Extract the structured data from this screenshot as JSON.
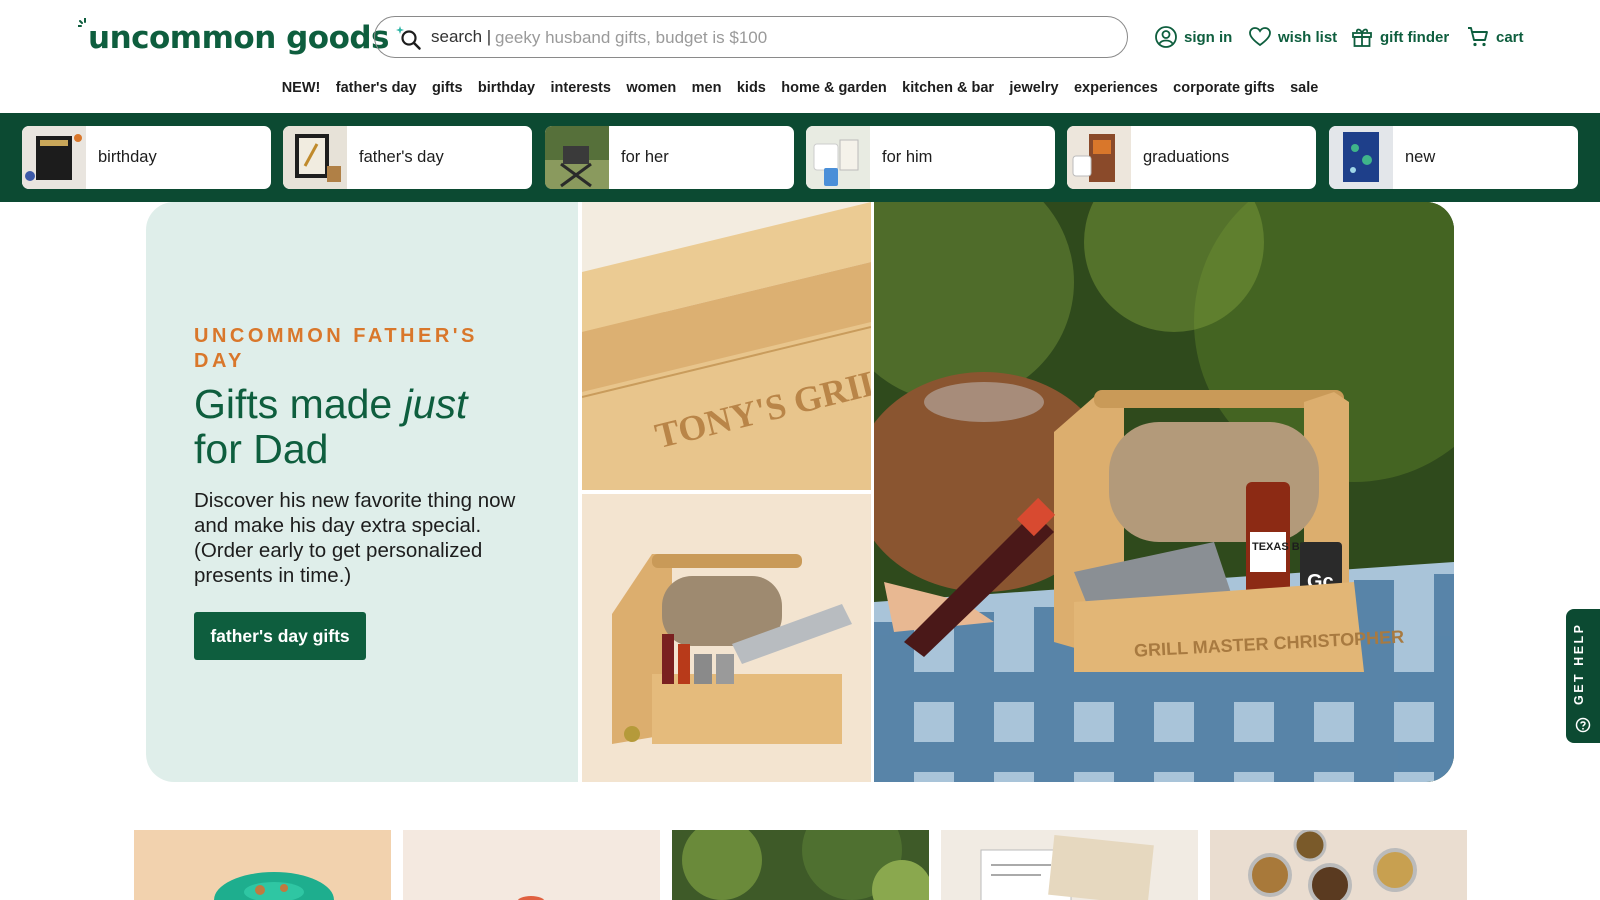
{
  "brand": {
    "name": "uncommon goods",
    "color": "#0e5e3e"
  },
  "search": {
    "prefix": "search |",
    "placeholder": "geeky husband gifts, budget is $100"
  },
  "utility": {
    "sign_in": "sign in",
    "wish_list": "wish list",
    "gift_finder": "gift finder",
    "cart": "cart"
  },
  "nav": [
    "NEW!",
    "father's day",
    "gifts",
    "birthday",
    "interests",
    "women",
    "men",
    "kids",
    "home & garden",
    "kitchen & bar",
    "jewelry",
    "experiences",
    "corporate gifts",
    "sale"
  ],
  "categories": [
    {
      "label": "birthday"
    },
    {
      "label": "father's day"
    },
    {
      "label": "for her"
    },
    {
      "label": "for him"
    },
    {
      "label": "graduations"
    },
    {
      "label": "new"
    }
  ],
  "hero": {
    "eyebrow": "UNCOMMON FATHER'S DAY",
    "headline_part1": "Gifts made ",
    "headline_italic": "just",
    "headline_part2": "for Dad",
    "description": "Discover his new favorite thing now and make his day extra special. (Order early to get personalized presents in time.)",
    "cta": "father's day gifts",
    "engraving_a": "TONY'S GRILL",
    "engraving_c": "GRILL MASTER CHRISTOPHER",
    "label_texas": "TEXAS BBQ",
    "label_gc": "Gc"
  },
  "help": {
    "label": "GET HELP"
  },
  "colors": {
    "dark_green": "#0c4a32",
    "accent_orange": "#d9772b",
    "hero_bg": "#dfeeea"
  }
}
